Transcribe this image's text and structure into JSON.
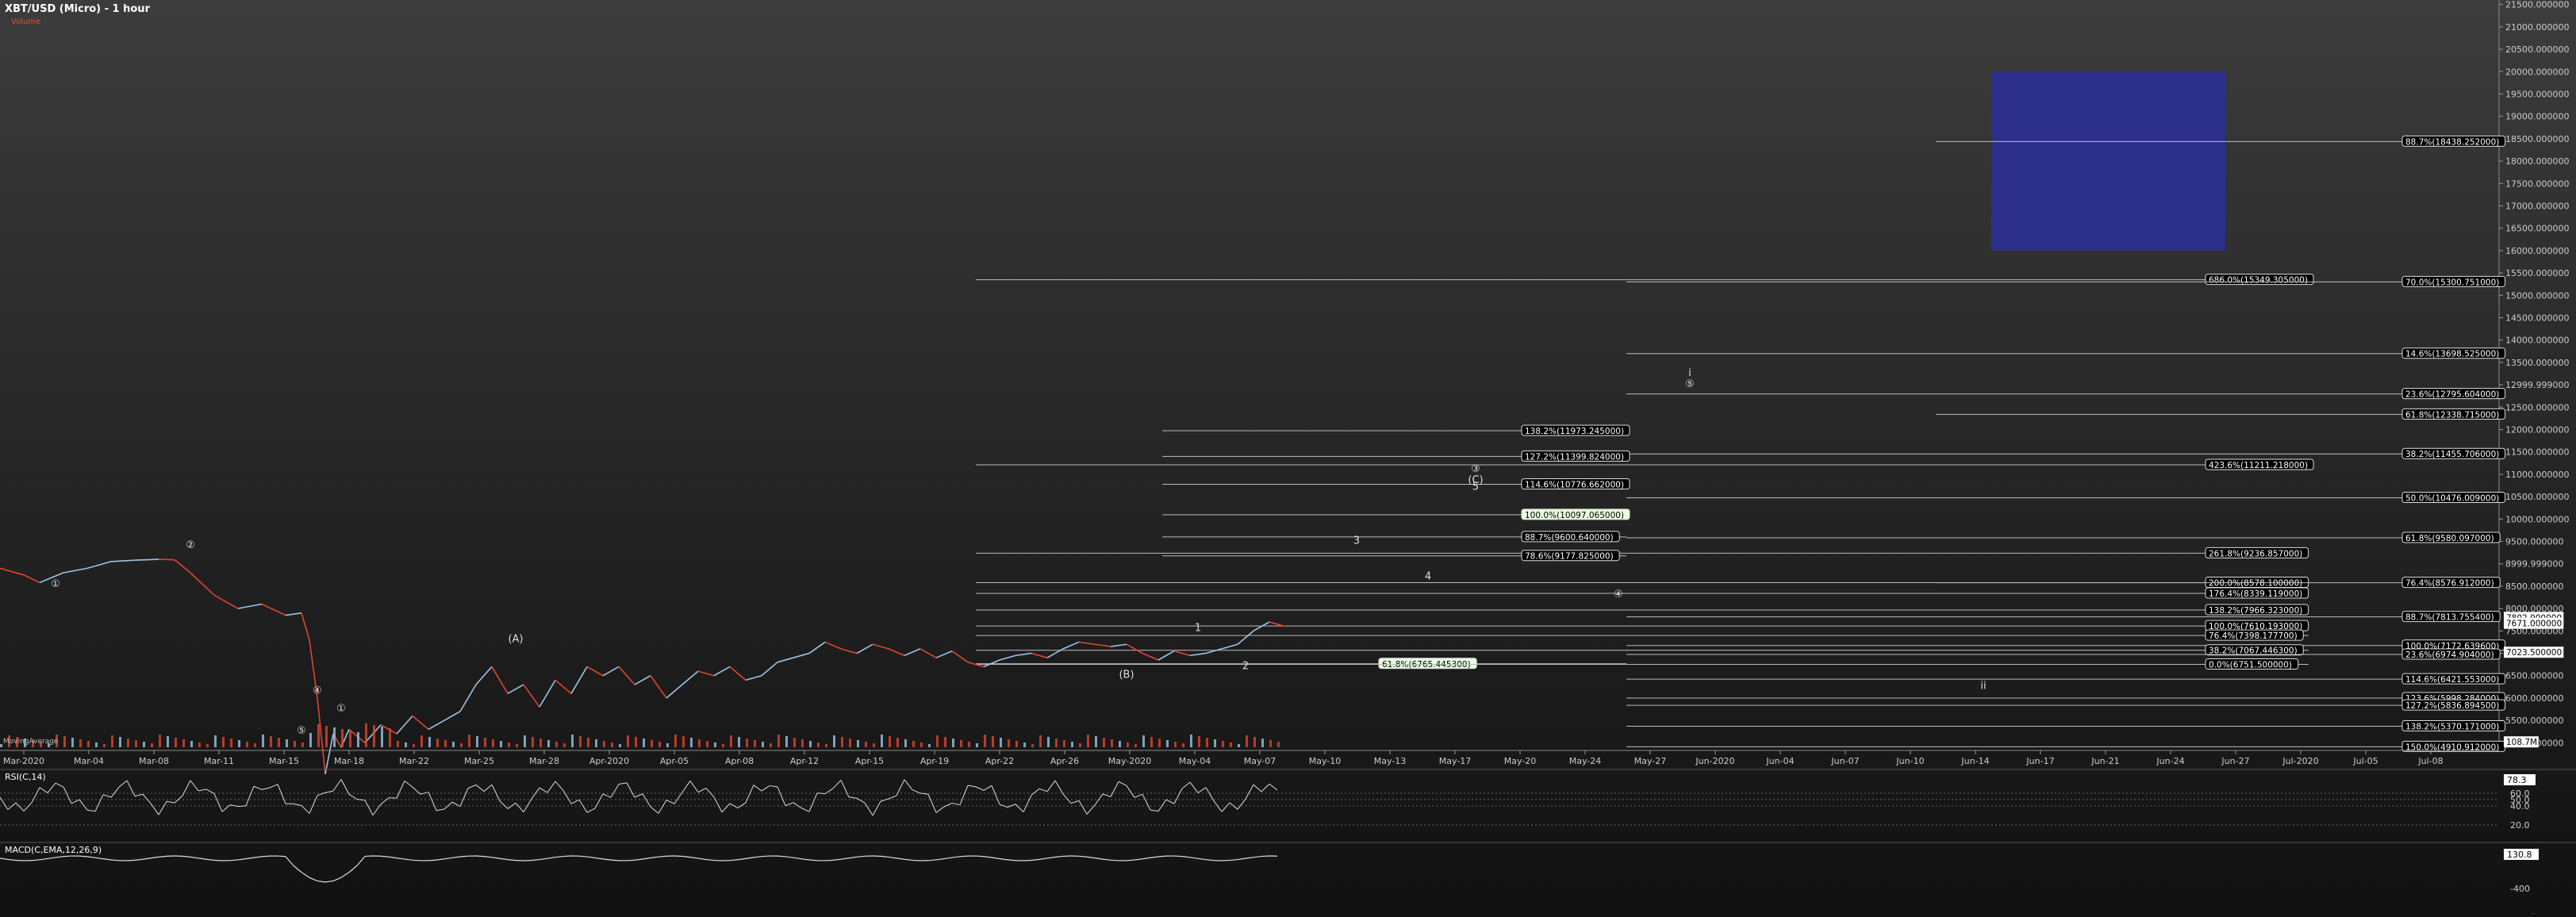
{
  "header": {
    "title": "XBT/USD (Micro) - 1 hour",
    "volume_label": "Volume",
    "vol_overlay_label": "MovingAverage"
  },
  "colors": {
    "up": "#9cc3e6",
    "down": "#e0442c",
    "fib_box": "#2c2f8f",
    "highlight": "#e8ffe0",
    "price_badge": "#ffffff"
  },
  "chart_data": {
    "type": "line",
    "title": "XBT/USD (Micro) - 1 hour",
    "y_axis_ticks": [
      "21500.000000",
      "21000.000000",
      "20500.000000",
      "20000.000000",
      "19500.000000",
      "19000.000000",
      "18500.000000",
      "18000.000000",
      "17500.000000",
      "17000.000000",
      "16500.000000",
      "16000.000000",
      "15500.000000",
      "15000.000000",
      "14500.000000",
      "14000.000000",
      "13500.000000",
      "12999.999000",
      "12500.000000",
      "12000.000000",
      "11500.000000",
      "11000.000000",
      "10500.000000",
      "10000.000000",
      "9500.000000",
      "8999.999000",
      "8500.000000",
      "8000.000000",
      "7500.000000",
      "7000.000000",
      "6500.000000",
      "6000.000000",
      "5500.000000",
      "5000.000000"
    ],
    "x_axis_ticks": [
      "Mar-2020",
      "Mar-04",
      "Mar-08",
      "Mar-11",
      "Mar-15",
      "Mar-18",
      "Mar-22",
      "Mar-25",
      "Mar-28",
      "Apr-2020",
      "Apr-05",
      "Apr-08",
      "Apr-12",
      "Apr-15",
      "Apr-19",
      "Apr-22",
      "Apr-26",
      "May-2020",
      "May-04",
      "May-07",
      "May-10",
      "May-13",
      "May-17",
      "May-20",
      "May-24",
      "May-27",
      "Jun-2020",
      "Jun-04",
      "Jun-07",
      "Jun-10",
      "Jun-14",
      "Jun-17",
      "Jun-21",
      "Jun-24",
      "Jun-27",
      "Jul-2020",
      "Jul-05",
      "Jul-08"
    ],
    "price_path": [
      [
        0,
        8900
      ],
      [
        3,
        8750
      ],
      [
        5,
        8580
      ],
      [
        8,
        8800
      ],
      [
        11,
        8900
      ],
      [
        14,
        9050
      ],
      [
        17,
        9080
      ],
      [
        20,
        9100
      ],
      [
        22,
        9090
      ],
      [
        24,
        8800
      ],
      [
        27,
        8300
      ],
      [
        30,
        8000
      ],
      [
        33,
        8100
      ],
      [
        36,
        7850
      ],
      [
        38,
        7900
      ],
      [
        39,
        7300
      ],
      [
        40,
        6000
      ],
      [
        41,
        4300
      ],
      [
        42,
        5200
      ],
      [
        43,
        4900
      ],
      [
        44,
        5300
      ],
      [
        46,
        5000
      ],
      [
        48,
        5400
      ],
      [
        50,
        5200
      ],
      [
        52,
        5600
      ],
      [
        54,
        5300
      ],
      [
        56,
        5500
      ],
      [
        58,
        5700
      ],
      [
        60,
        6300
      ],
      [
        62,
        6700
      ],
      [
        64,
        6100
      ],
      [
        66,
        6300
      ],
      [
        68,
        5800
      ],
      [
        70,
        6400
      ],
      [
        72,
        6100
      ],
      [
        74,
        6700
      ],
      [
        76,
        6500
      ],
      [
        78,
        6700
      ],
      [
        80,
        6300
      ],
      [
        82,
        6500
      ],
      [
        84,
        6000
      ],
      [
        86,
        6300
      ],
      [
        88,
        6600
      ],
      [
        90,
        6500
      ],
      [
        92,
        6700
      ],
      [
        94,
        6400
      ],
      [
        96,
        6500
      ],
      [
        98,
        6800
      ],
      [
        100,
        6900
      ],
      [
        102,
        7000
      ],
      [
        104,
        7250
      ],
      [
        106,
        7100
      ],
      [
        108,
        7000
      ],
      [
        110,
        7200
      ],
      [
        112,
        7100
      ],
      [
        114,
        6950
      ],
      [
        116,
        7100
      ],
      [
        118,
        6900
      ],
      [
        120,
        7050
      ],
      [
        122,
        6800
      ],
      [
        124,
        6700
      ],
      [
        126,
        6850
      ],
      [
        128,
        6950
      ],
      [
        130,
        7000
      ],
      [
        132,
        6900
      ],
      [
        134,
        7100
      ],
      [
        136,
        7250
      ],
      [
        138,
        7200
      ],
      [
        140,
        7150
      ],
      [
        142,
        7200
      ],
      [
        144,
        7000
      ],
      [
        146,
        6850
      ],
      [
        148,
        7050
      ],
      [
        150,
        6950
      ],
      [
        152,
        7000
      ],
      [
        154,
        7100
      ],
      [
        156,
        7200
      ],
      [
        158,
        7500
      ],
      [
        160,
        7700
      ],
      [
        162,
        7600
      ]
    ],
    "volume_series_name": "Volume",
    "indicators": [
      {
        "name": "RSI(C,14)",
        "ticks": [
          "60.0",
          "50.0",
          "40.0",
          "20.0"
        ],
        "current": "78.3"
      },
      {
        "name": "MACD(C,EMA,12,26,9)",
        "ticks": [
          "-400"
        ],
        "current": "130.8"
      }
    ],
    "y_markers": [
      {
        "label": "7802.000000",
        "price": 7802,
        "style": "white"
      },
      {
        "label": "7671.000000",
        "price": 7671,
        "style": "white"
      },
      {
        "label": "7023.500000",
        "price": 7023.5,
        "style": "badge"
      },
      {
        "label": "108.7M",
        "price": 5020,
        "style": "white"
      }
    ],
    "ellipsis_label": "...",
    "fib_levels": [
      {
        "label": "88.7%(18438.252000)",
        "price": 18438.252,
        "x_start": 295,
        "side": "right"
      },
      {
        "label": "686.0%(15349.305000)",
        "price": 15349.305,
        "x_start": 150,
        "side": "mid"
      },
      {
        "label": "70.0%(15300.751000)",
        "price": 15300.751,
        "x_start": 248,
        "side": "right"
      },
      {
        "label": "14.6%(13698.525000)",
        "price": 13698.525,
        "x_start": 248,
        "side": "right"
      },
      {
        "label": "23.6%(12795.604000)",
        "price": 12795.604,
        "x_start": 248,
        "side": "right"
      },
      {
        "label": "61.8%(12338.715000)",
        "price": 12338.715,
        "x_start": 295,
        "side": "right"
      },
      {
        "label": "138.2%(11973.245000)",
        "price": 11973.245,
        "x_start": 178,
        "side": "left"
      },
      {
        "label": "38.2%(11455.706000)",
        "price": 11455.706,
        "x_start": 248,
        "side": "right"
      },
      {
        "label": "127.2%(11399.824000)",
        "price": 11399.824,
        "x_start": 178,
        "side": "left"
      },
      {
        "label": "423.6%(11211.218000)",
        "price": 11211.218,
        "x_start": 150,
        "side": "mid"
      },
      {
        "label": "114.6%(10776.662000)",
        "price": 10776.662,
        "x_start": 178,
        "side": "left"
      },
      {
        "label": "50.0%(10476.009000)",
        "price": 10476.009,
        "x_start": 248,
        "side": "right"
      },
      {
        "label": "100.0%(10097.065000)",
        "price": 10097.065,
        "x_start": 178,
        "side": "left",
        "highlight": true
      },
      {
        "label": "88.7%(9600.640000)",
        "price": 9600.64,
        "x_start": 178,
        "side": "left"
      },
      {
        "label": "61.8%(9580.097000)",
        "price": 9580.097,
        "x_start": 248,
        "side": "right"
      },
      {
        "label": "261.8%(9236.857000)",
        "price": 9236.857,
        "x_start": 150,
        "side": "mid"
      },
      {
        "label": "78.6%(9177.825000)",
        "price": 9177.825,
        "x_start": 178,
        "side": "left"
      },
      {
        "label": "200.0%(8578.100000)",
        "price": 8578.1,
        "x_start": 150,
        "side": "mid"
      },
      {
        "label": "76.4%(8576.912000)",
        "price": 8576.912,
        "x_start": 295,
        "side": "right"
      },
      {
        "label": "176.4%(8339.119000)",
        "price": 8339.119,
        "x_start": 150,
        "side": "mid"
      },
      {
        "label": "138.2%(7966.323000)",
        "price": 7966.323,
        "x_start": 150,
        "side": "mid"
      },
      {
        "label": "88.7%(7813.755400)",
        "price": 7813.7554,
        "x_start": 248,
        "side": "right"
      },
      {
        "label": "100.0%(7610.193000)",
        "price": 7610.193,
        "x_start": 150,
        "side": "mid"
      },
      {
        "label": "76.4%(7398.177700)",
        "price": 7398.1777,
        "x_start": 150,
        "side": "mid"
      },
      {
        "label": "100.0%(7172.639600)",
        "price": 7172.6396,
        "x_start": 248,
        "side": "right"
      },
      {
        "label": "38.2%(7067.446300)",
        "price": 7067.4463,
        "x_start": 150,
        "side": "mid"
      },
      {
        "label": "23.6%(6974.904000)",
        "price": 6974.904,
        "x_start": 248,
        "side": "right"
      },
      {
        "label": "61.8%(6765.445300)",
        "price": 6765.4453,
        "x_start": 150,
        "side": "center",
        "highlight": true
      },
      {
        "label": "0.0%(6751.500000)",
        "price": 6751.5,
        "x_start": 150,
        "side": "mid"
      },
      {
        "label": "114.6%(6421.553000)",
        "price": 6421.553,
        "x_start": 248,
        "side": "right"
      },
      {
        "label": "123.6%(5998.284000)",
        "price": 5998.284,
        "x_start": 248,
        "side": "right"
      },
      {
        "label": "127.2%(5836.894500)",
        "price": 5836.8945,
        "x_start": 248,
        "side": "right"
      },
      {
        "label": "138.2%(5370.171000)",
        "price": 5370.171,
        "x_start": 248,
        "side": "right"
      },
      {
        "label": "150.0%(4910.912000)",
        "price": 4910.912,
        "x_start": 248,
        "side": "right"
      }
    ],
    "wave_labels": [
      {
        "text": "①",
        "x": 7,
        "price": 8480
      },
      {
        "text": "②",
        "x": 24,
        "price": 9350
      },
      {
        "text": "④",
        "x": 40,
        "price": 6100
      },
      {
        "text": "①",
        "x": 43,
        "price": 5700
      },
      {
        "text": "⑤",
        "x": 38,
        "price": 5200
      },
      {
        "text": "(A)",
        "x": 65,
        "price": 7250
      },
      {
        "text": "(B)",
        "x": 142,
        "price": 6450
      },
      {
        "text": "1",
        "x": 151,
        "price": 7500
      },
      {
        "text": "2",
        "x": 157,
        "price": 6650
      },
      {
        "text": "3",
        "x": 171,
        "price": 9450
      },
      {
        "text": "4",
        "x": 180,
        "price": 8650
      },
      {
        "text": "③",
        "x": 186,
        "price": 11050
      },
      {
        "text": "(C)",
        "x": 186,
        "price": 10800
      },
      {
        "text": "5",
        "x": 186,
        "price": 10650
      },
      {
        "text": "④",
        "x": 204,
        "price": 8250
      },
      {
        "text": "i",
        "x": 213,
        "price": 13200
      },
      {
        "text": "⑤",
        "x": 213,
        "price": 12950
      },
      {
        "text": "ii",
        "x": 250,
        "price": 6200
      }
    ],
    "target_box": {
      "x_start": 250,
      "x_end": 280,
      "price_top": 20000,
      "price_bottom": 16000
    },
    "ylim": [
      4900,
      21600
    ]
  }
}
